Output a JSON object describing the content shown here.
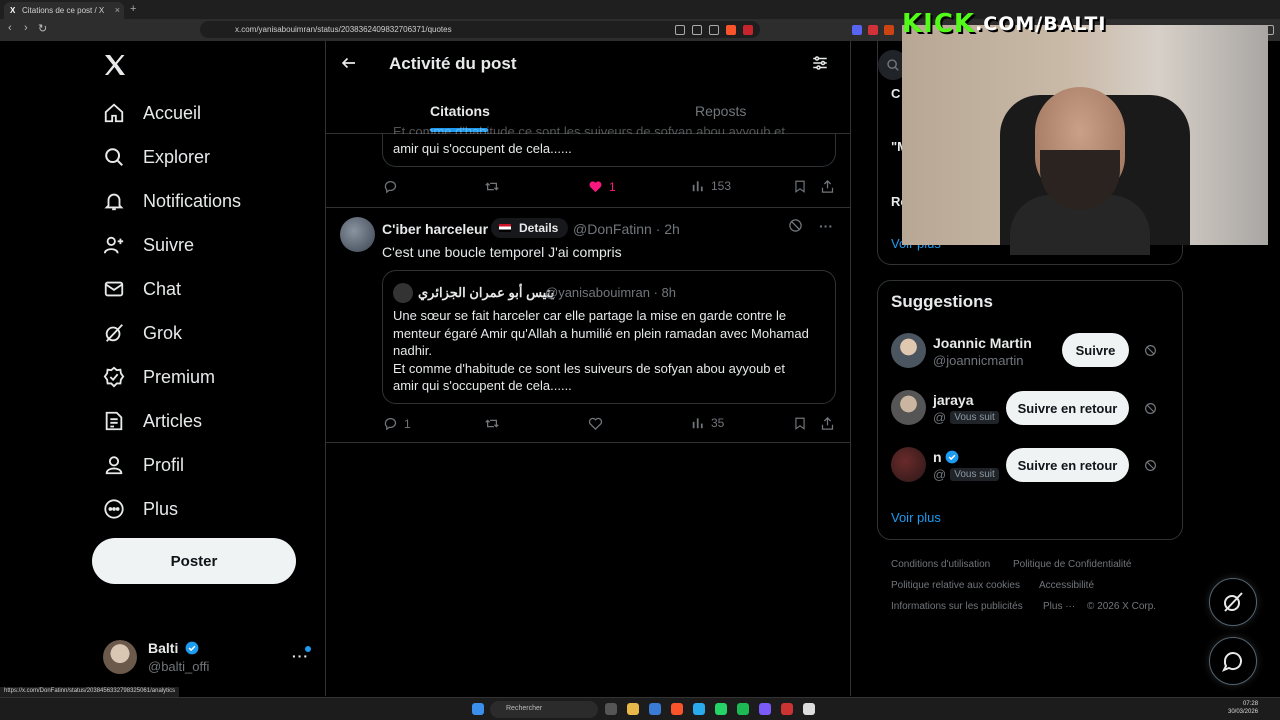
{
  "browser": {
    "tab_title": "Citations de ce post / X",
    "url": "x.com/yanisabouimran/status/2038362409832706371/quotes",
    "status_url": "https://x.com/DonFatinn/status/2038456332798325061/analytics"
  },
  "nav": {
    "items": [
      {
        "label": "Accueil",
        "icon": "home-icon"
      },
      {
        "label": "Explorer",
        "icon": "search-icon"
      },
      {
        "label": "Notifications",
        "icon": "bell-icon"
      },
      {
        "label": "Suivre",
        "icon": "add-user-icon"
      },
      {
        "label": "Chat",
        "icon": "mail-icon"
      },
      {
        "label": "Grok",
        "icon": "grok-icon"
      },
      {
        "label": "Premium",
        "icon": "verified-icon"
      },
      {
        "label": "Articles",
        "icon": "article-icon"
      },
      {
        "label": "Profil",
        "icon": "person-icon"
      },
      {
        "label": "Plus",
        "icon": "more-circle-icon"
      }
    ],
    "post_button": "Poster"
  },
  "account": {
    "name": "Balti",
    "handle": "@balti_offi"
  },
  "header": {
    "title": "Activité du post",
    "tabs": [
      "Citations",
      "Reposts"
    ]
  },
  "prev_post": {
    "quote_tail": "amir qui s'occupent de cela......",
    "quote_cut": "Et comme d'habitude ce sont les suiveurs de sofyan abou ayyoub et",
    "likes": "1",
    "views": "153"
  },
  "post": {
    "name": "C'iber harceleur",
    "badge": "Details",
    "handle_time": "@DonFatinn · 2h",
    "text": "C'est une boucle temporel J'ai compris",
    "quote": {
      "name": "يتيس أبو عمران الجزائري",
      "handle_time": "@yanisabouimran · 8h",
      "line1": "Une sœur se fait harceler car elle partage la mise en garde contre le",
      "line2": "menteur égaré Amir qu'Allah a humilié en plein ramadan avec Mohamad",
      "line3": "nadhir.",
      "line4": "Et comme d'habitude ce sont les suiveurs de sofyan abou ayyoub et",
      "line5": "amir qui s'occupent de cela......"
    },
    "replies": "1",
    "views": "35"
  },
  "right": {
    "trend_frags": [
      "C",
      "\"M",
      "Ro"
    ],
    "voir_plus": "Voir plus",
    "suggestions_title": "Suggestions",
    "suggestions": [
      {
        "name": "Joannic Martin",
        "handle": "@joannicmartin",
        "button": "Suivre"
      },
      {
        "name": "jaraya",
        "handle": "@",
        "follows_you": "Vous suit",
        "button": "Suivre en retour"
      },
      {
        "name": "n",
        "handle": "@",
        "follows_you": "Vous suit",
        "button": "Suivre en retour"
      }
    ],
    "footer": {
      "terms": "Conditions d'utilisation",
      "privacy": "Politique de Confidentialité",
      "cookies": "Politique relative aux cookies",
      "accessibility": "Accessibilité",
      "ads": "Informations sur les publicités",
      "more": "Plus ···",
      "copyright": "© 2026 X Corp."
    }
  },
  "overlay": {
    "kick": "KICK",
    "kick_rest": ".COM/BALTI"
  },
  "taskbar": {
    "search": "Rechercher",
    "time": "07:28",
    "date": "30/03/2026"
  },
  "colors": {
    "accent": "#1d9bf0",
    "like": "#f91880",
    "background": "#000000",
    "kick_green": "#53fc18"
  }
}
